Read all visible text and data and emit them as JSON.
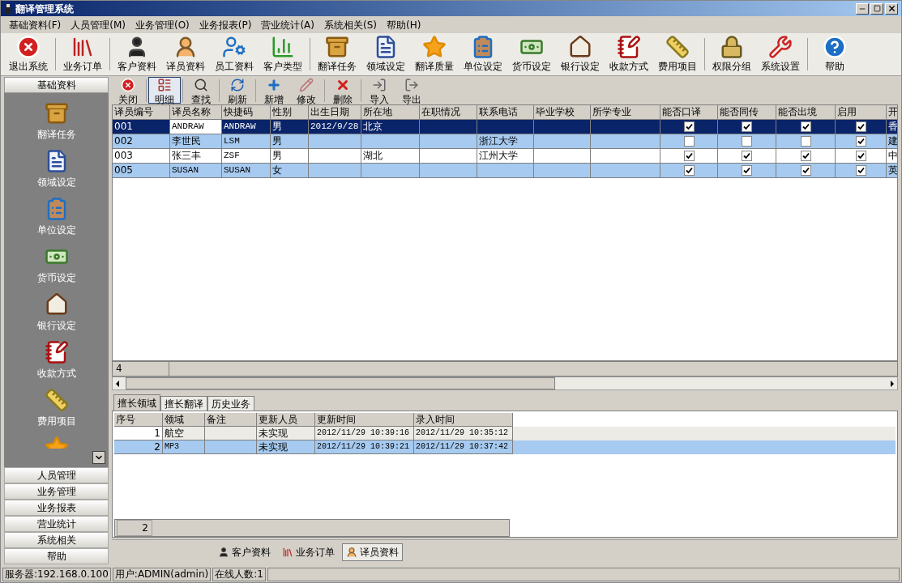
{
  "window": {
    "title": "翻译管理系统"
  },
  "menu": [
    "基础资料(F)",
    "人员管理(M)",
    "业务管理(O)",
    "业务报表(P)",
    "营业统计(A)",
    "系统相关(S)",
    "帮助(H)"
  ],
  "toolbar": {
    "groups": [
      [
        "退出系统"
      ],
      [
        "业务订单"
      ],
      [
        "客户资料",
        "译员资料",
        "员工资料",
        "客户类型"
      ],
      [
        "翻译任务",
        "领域设定",
        "翻译质量",
        "单位设定",
        "货币设定",
        "银行设定",
        "收款方式",
        "费用项目"
      ],
      [
        "权限分组",
        "系统设置"
      ],
      [
        "帮助"
      ]
    ]
  },
  "sidebar": {
    "header": "基础资料",
    "expanded": true,
    "items": [
      "翻译任务",
      "领域设定",
      "单位设定",
      "货币设定",
      "银行设定",
      "收款方式",
      "费用项目"
    ],
    "groups": [
      "人员管理",
      "业务管理",
      "业务报表",
      "营业统计",
      "系统相关",
      "帮助"
    ]
  },
  "actions": {
    "groups": [
      [
        {
          "label": "关闭",
          "selected": false
        }
      ],
      [
        {
          "label": "明细",
          "selected": true
        }
      ],
      [
        {
          "label": "查找",
          "selected": false
        }
      ],
      [
        {
          "label": "刷新",
          "selected": false
        }
      ],
      [
        {
          "label": "新增",
          "selected": false
        },
        {
          "label": "修改",
          "selected": false
        }
      ],
      [
        {
          "label": "删除",
          "selected": false
        }
      ],
      [
        {
          "label": "导入",
          "selected": false
        },
        {
          "label": "导出",
          "selected": false
        }
      ]
    ]
  },
  "table": {
    "columns": [
      "译员编号",
      "译员名称",
      "快捷码",
      "性别",
      "出生日期",
      "所在地",
      "在职情况",
      "联系电话",
      "毕业学校",
      "所学专业",
      "能否口译",
      "能否同传",
      "能否出境",
      "启用",
      "开"
    ],
    "rows": [
      {
        "selected": true,
        "cells": [
          "001",
          {
            "text": "ANDRAW",
            "focused": true
          },
          "ANDRAW",
          "男",
          "2012/9/28",
          "北京",
          "",
          "",
          "",
          "",
          true,
          true,
          true,
          true,
          "香"
        ]
      },
      {
        "selected": false,
        "cells": [
          "002",
          "李世民",
          "LSM",
          "男",
          "",
          "",
          "",
          "浙江大学",
          "",
          "",
          false,
          false,
          false,
          true,
          "建"
        ]
      },
      {
        "selected": false,
        "cells": [
          "003",
          "张三丰",
          "ZSF",
          "男",
          "",
          "湖北",
          "",
          "江州大学",
          "",
          "",
          true,
          true,
          true,
          true,
          "中"
        ]
      },
      {
        "selected": false,
        "cells": [
          "005",
          "SUSAN",
          "SUSAN",
          "女",
          "",
          "",
          "",
          "",
          "",
          "",
          true,
          true,
          true,
          true,
          "英"
        ]
      }
    ],
    "footer": "4"
  },
  "detail_tabs": [
    {
      "label": "擅长领域",
      "selected": true
    },
    {
      "label": "擅长翻译",
      "selected": false
    },
    {
      "label": "历史业务",
      "selected": false
    }
  ],
  "detail_table": {
    "columns": [
      "序号",
      "领域",
      "备注",
      "更新人员",
      "更新时间",
      "录入时间"
    ],
    "rows": [
      {
        "selected": false,
        "cells": [
          "1",
          "航空",
          "",
          "未实现",
          "2012/11/29 10:39:16",
          "2012/11/29 10:35:12"
        ]
      },
      {
        "selected": true,
        "cells": [
          "2",
          "MP3",
          "",
          "未实现",
          "2012/11/29 10:39:21",
          "2012/11/29 10:37:42"
        ]
      }
    ],
    "footer": "2"
  },
  "window_tabs": [
    {
      "label": "客户资料",
      "selected": false
    },
    {
      "label": "业务订单",
      "selected": false
    },
    {
      "label": "译员资料",
      "selected": true
    }
  ],
  "status_bar": [
    "服务器:192.168.0.100",
    "用户:ADMIN(admin)",
    "在线人数:1"
  ]
}
